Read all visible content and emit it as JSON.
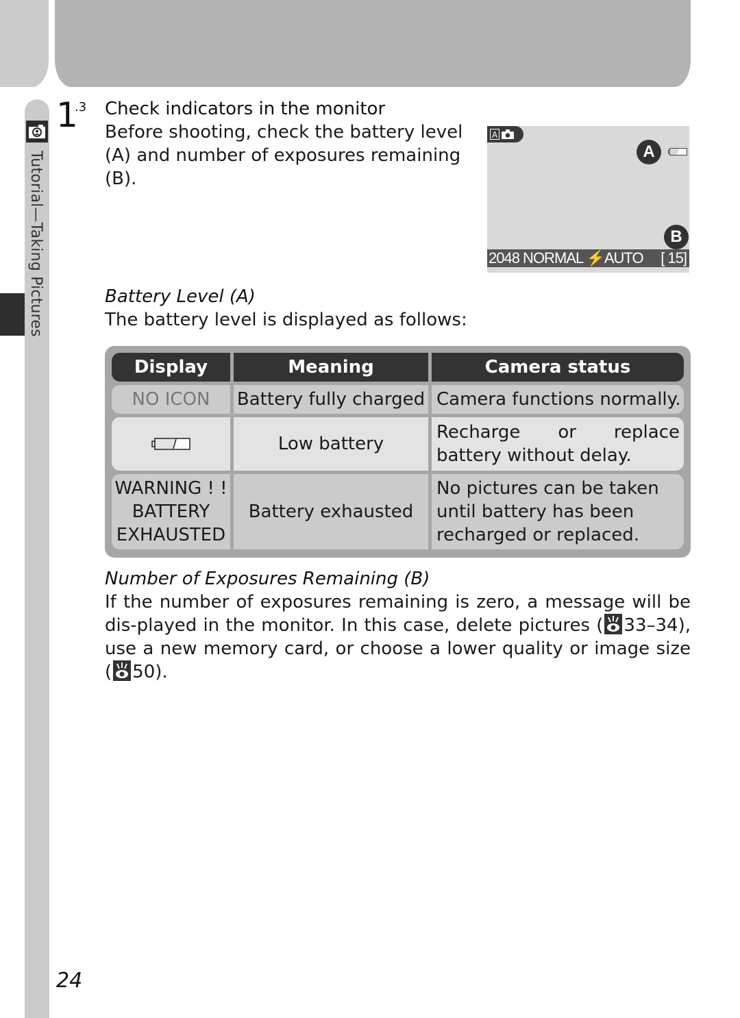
{
  "chapter": {
    "side_label": "Tutorial—Taking Pictures",
    "side_icon": "camera-portrait-icon"
  },
  "step": {
    "number": "1",
    "sub": ".3",
    "title": "Check indicators in the monitor",
    "body": "Before shooting, check the battery level (A) and number of exposures remaining (B)."
  },
  "monitor": {
    "mode_letter": "A",
    "mode_icon": "camera-icon",
    "label_a": "A",
    "label_b": "B",
    "battery_icon": "low-battery-icon",
    "status_left": "2048 NORMAL ⚡AUTO",
    "status_right": "[   15]"
  },
  "battery_section": {
    "title": "Battery Level (A)",
    "intro": "The battery level is displayed as follows:"
  },
  "table": {
    "headers": [
      "Display",
      "Meaning",
      "Camera status"
    ],
    "rows": [
      {
        "display": "NO ICON",
        "meaning": "Battery fully charged",
        "status": "Camera functions normally."
      },
      {
        "display": "low-battery-icon",
        "meaning": "Low battery",
        "status": "Recharge or replace battery without delay."
      },
      {
        "display": "WARNING ! ! BATTERY EXHAUSTED",
        "display_lines": [
          "WARNING ! !",
          "BATTERY",
          "EXHAUSTED"
        ],
        "meaning": "Battery exhausted",
        "status": "No pictures can be taken until battery has been recharged or replaced."
      }
    ]
  },
  "exposures_section": {
    "title": "Number of Exposures Remaining (B)",
    "body_part1": "If the number of exposures remaining is zero, a message will be dis-played in the monitor.  In this case, delete pictures (",
    "ref1": "33–34",
    "body_part2": "), use a new memory card, or choose a lower quality or image size (",
    "ref2": "50",
    "body_part3": ").",
    "ref_icon": "page-reference-icon"
  },
  "page_number": "24"
}
